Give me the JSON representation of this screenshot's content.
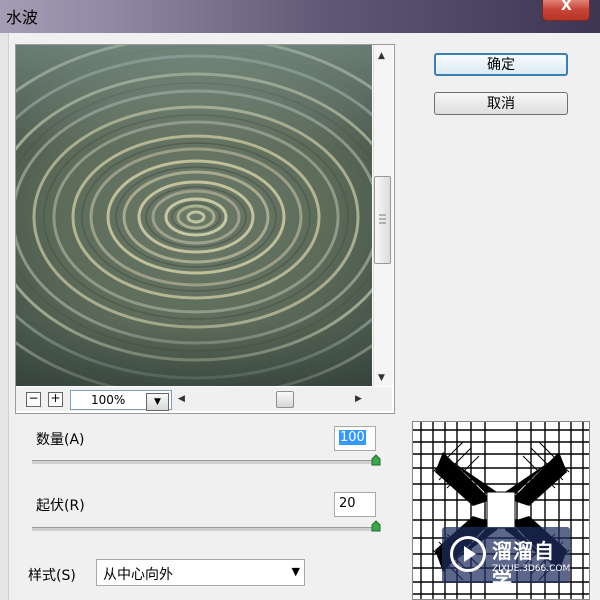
{
  "window": {
    "title": "水波",
    "close_glyph": "X"
  },
  "buttons": {
    "ok": "确定",
    "cancel": "取消"
  },
  "preview": {
    "zoom": "100%",
    "zoom_out": "−",
    "zoom_in": "+"
  },
  "amount": {
    "label": "数量(A)",
    "value": "100",
    "slider_fraction": 1.0
  },
  "ridges": {
    "label": "起伏(R)",
    "value": "20",
    "slider_fraction": 1.0
  },
  "style": {
    "label": "样式(S)",
    "value": "从中心向外"
  },
  "watermark": {
    "text": "溜溜自学",
    "url": "ZIXUE.3D66.COM"
  },
  "icons": [
    "scroll-up-icon",
    "scroll-down-icon",
    "scroll-left-icon",
    "scroll-right-icon",
    "chevron-down-icon",
    "play-logo-icon",
    "close-icon"
  ],
  "colors": {
    "title_gradient_end": "#3d3552",
    "default_button_border": "#3c7fb1",
    "selection": "#3399ff",
    "slider_thumb": "#3aa84a"
  }
}
